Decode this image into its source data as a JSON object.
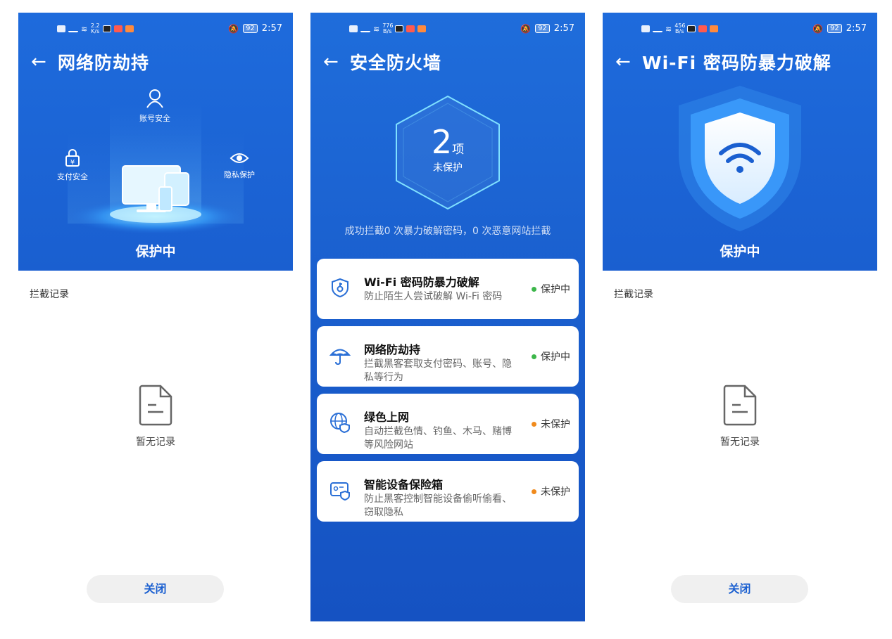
{
  "screens": [
    {
      "status_bar": {
        "left_text": "2.2",
        "left_unit": "K/s",
        "battery": "92",
        "time": "2:57"
      },
      "title": "网络防劫持",
      "features": {
        "account": "账号安全",
        "payment": "支付安全",
        "privacy": "隐私保护"
      },
      "hero_status": "保护中",
      "section_label": "拦截记录",
      "empty_text": "暂无记录",
      "close_label": "关闭"
    },
    {
      "status_bar": {
        "left_text": "776",
        "left_unit": "B/s",
        "battery": "92",
        "time": "2:57"
      },
      "title": "安全防火墙",
      "badge": {
        "count": "2",
        "unit": "项",
        "label": "未保护"
      },
      "summary": "成功拦截0 次暴力破解密码，0 次恶意网站拦截",
      "items": [
        {
          "title": "Wi-Fi 密码防暴力破解",
          "desc": "防止陌生人尝试破解 Wi-Fi 密码",
          "status": "保护中",
          "status_color": "#3cb64a",
          "icon": "wifi-key-shield-icon"
        },
        {
          "title": "网络防劫持",
          "desc": "拦截黑客套取支付密码、账号、隐私等行为",
          "status": "保护中",
          "status_color": "#3cb64a",
          "icon": "umbrella-icon"
        },
        {
          "title": "绿色上网",
          "desc": "自动拦截色情、钓鱼、木马、赌博等风险网站",
          "status": "未保护",
          "status_color": "#f08a1c",
          "icon": "globe-shield-icon"
        },
        {
          "title": "智能设备保险箱",
          "desc": "防止黑客控制智能设备偷听偷看、窃取隐私",
          "status": "未保护",
          "status_color": "#f08a1c",
          "icon": "device-shield-icon"
        }
      ]
    },
    {
      "status_bar": {
        "left_text": "456",
        "left_unit": "B/s",
        "battery": "92",
        "time": "2:57"
      },
      "title": "Wi-Fi 密码防暴力破解",
      "hero_status": "保护中",
      "section_label": "拦截记录",
      "empty_text": "暂无记录",
      "close_label": "关闭"
    }
  ]
}
